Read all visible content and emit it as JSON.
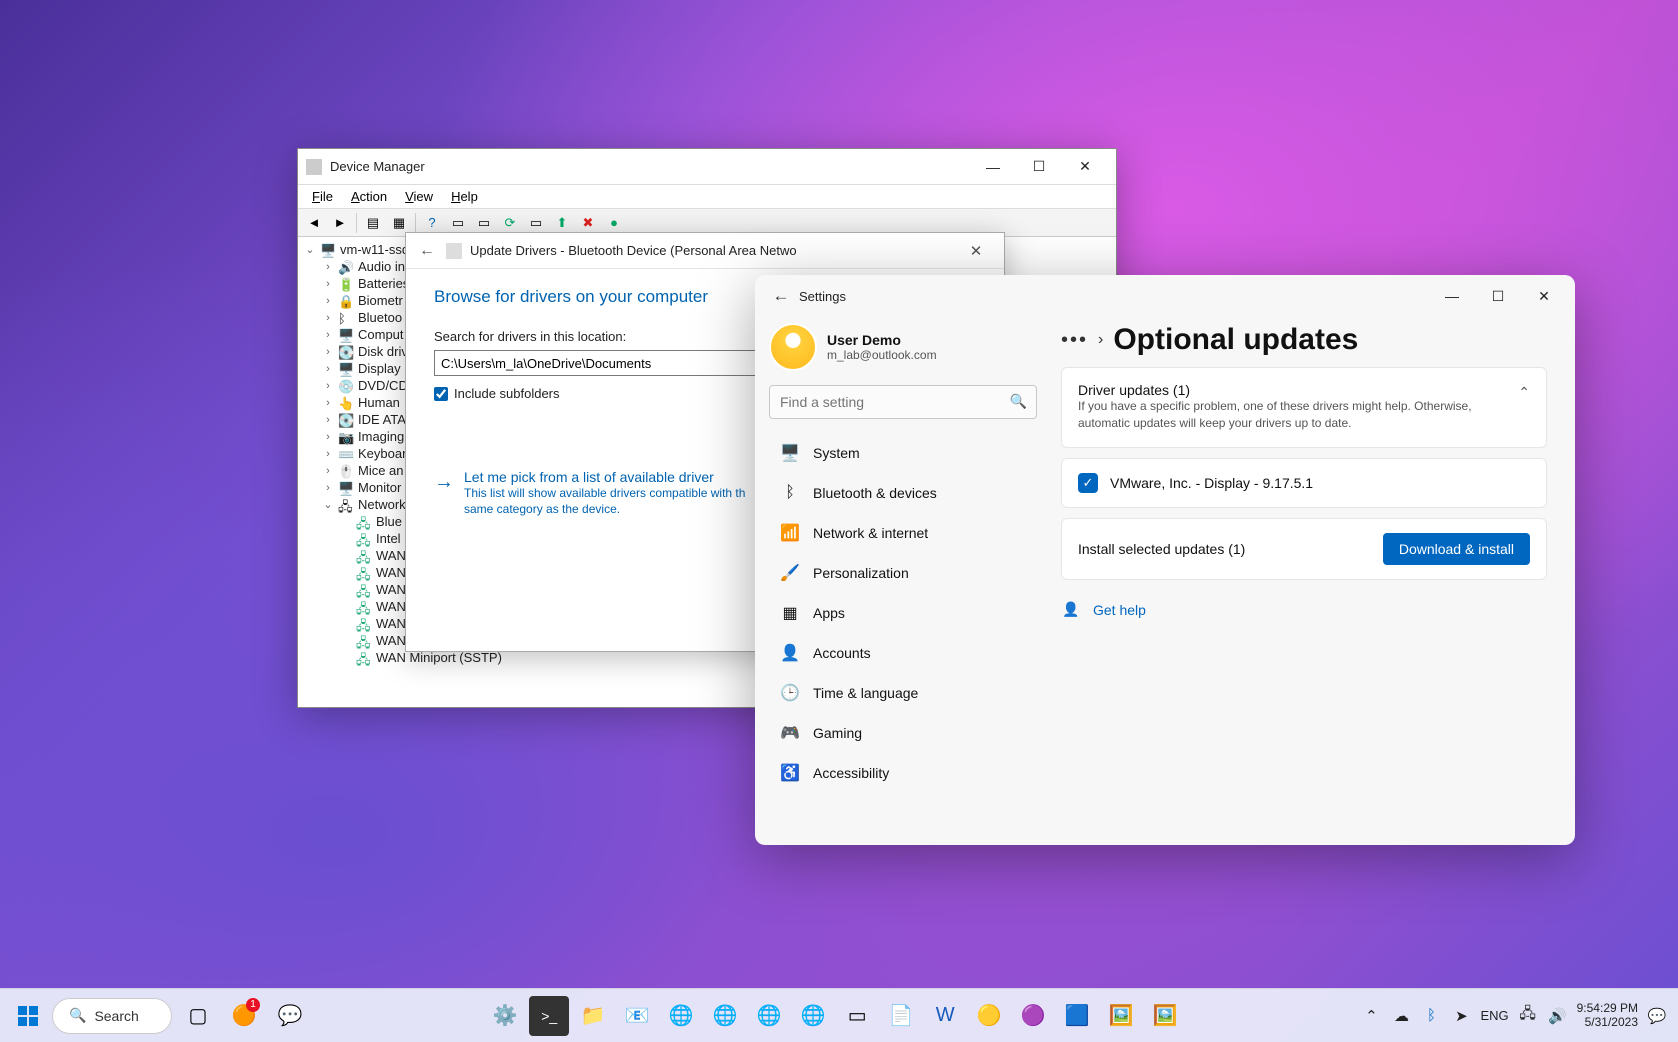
{
  "device_manager": {
    "title": "Device Manager",
    "menubar": {
      "file": "File",
      "action": "Action",
      "view": "View",
      "help": "Help"
    },
    "root_node": "vm-w11-ssd",
    "categories": [
      "Audio in",
      "Batteries",
      "Biometr",
      "Bluetoo",
      "Comput",
      "Disk driv",
      "Display",
      "DVD/CD",
      "Human",
      "IDE ATA",
      "Imaging",
      "Keyboar",
      "Mice an",
      "Monitor",
      "Network"
    ],
    "network_children": [
      "Blue",
      "Intel",
      "WAN",
      "WAN",
      "WAN",
      "WAN",
      "WAN",
      "WAN",
      "WAN Miniport (SSTP)"
    ]
  },
  "update_drivers": {
    "header": "Update Drivers - Bluetooth Device (Personal Area Netwo",
    "heading": "Browse for drivers on your computer",
    "search_label": "Search for drivers in this location:",
    "path_value": "C:\\Users\\m_la\\OneDrive\\Documents",
    "include_subfolders": "Include subfolders",
    "option_title": "Let me pick from a list of available driver",
    "option_desc": "This list will show available drivers compatible with th\nsame category as the device."
  },
  "settings": {
    "title": "Settings",
    "user": {
      "name": "User Demo",
      "email": "m_lab@outlook.com"
    },
    "search_placeholder": "Find a setting",
    "nav": [
      {
        "icon": "🖥️",
        "label": "System"
      },
      {
        "icon": "ᛒ",
        "label": "Bluetooth & devices"
      },
      {
        "icon": "📶",
        "label": "Network & internet"
      },
      {
        "icon": "🖌️",
        "label": "Personalization"
      },
      {
        "icon": "▦",
        "label": "Apps"
      },
      {
        "icon": "👤",
        "label": "Accounts"
      },
      {
        "icon": "🕒",
        "label": "Time & language"
      },
      {
        "icon": "🎮",
        "label": "Gaming"
      },
      {
        "icon": "♿",
        "label": "Accessibility"
      }
    ],
    "page_title": "Optional updates",
    "driver_card": {
      "title": "Driver updates (1)",
      "desc": "If you have a specific problem, one of these drivers might help. Otherwise, automatic updates will keep your drivers up to date."
    },
    "driver_item": "VMware, Inc. - Display - 9.17.5.1",
    "install_text": "Install selected updates (1)",
    "install_button": "Download & install",
    "get_help": "Get help"
  },
  "taskbar": {
    "search_label": "Search",
    "lang": "ENG",
    "time": "9:54:29 PM",
    "date": "5/31/2023",
    "badge": "1"
  }
}
